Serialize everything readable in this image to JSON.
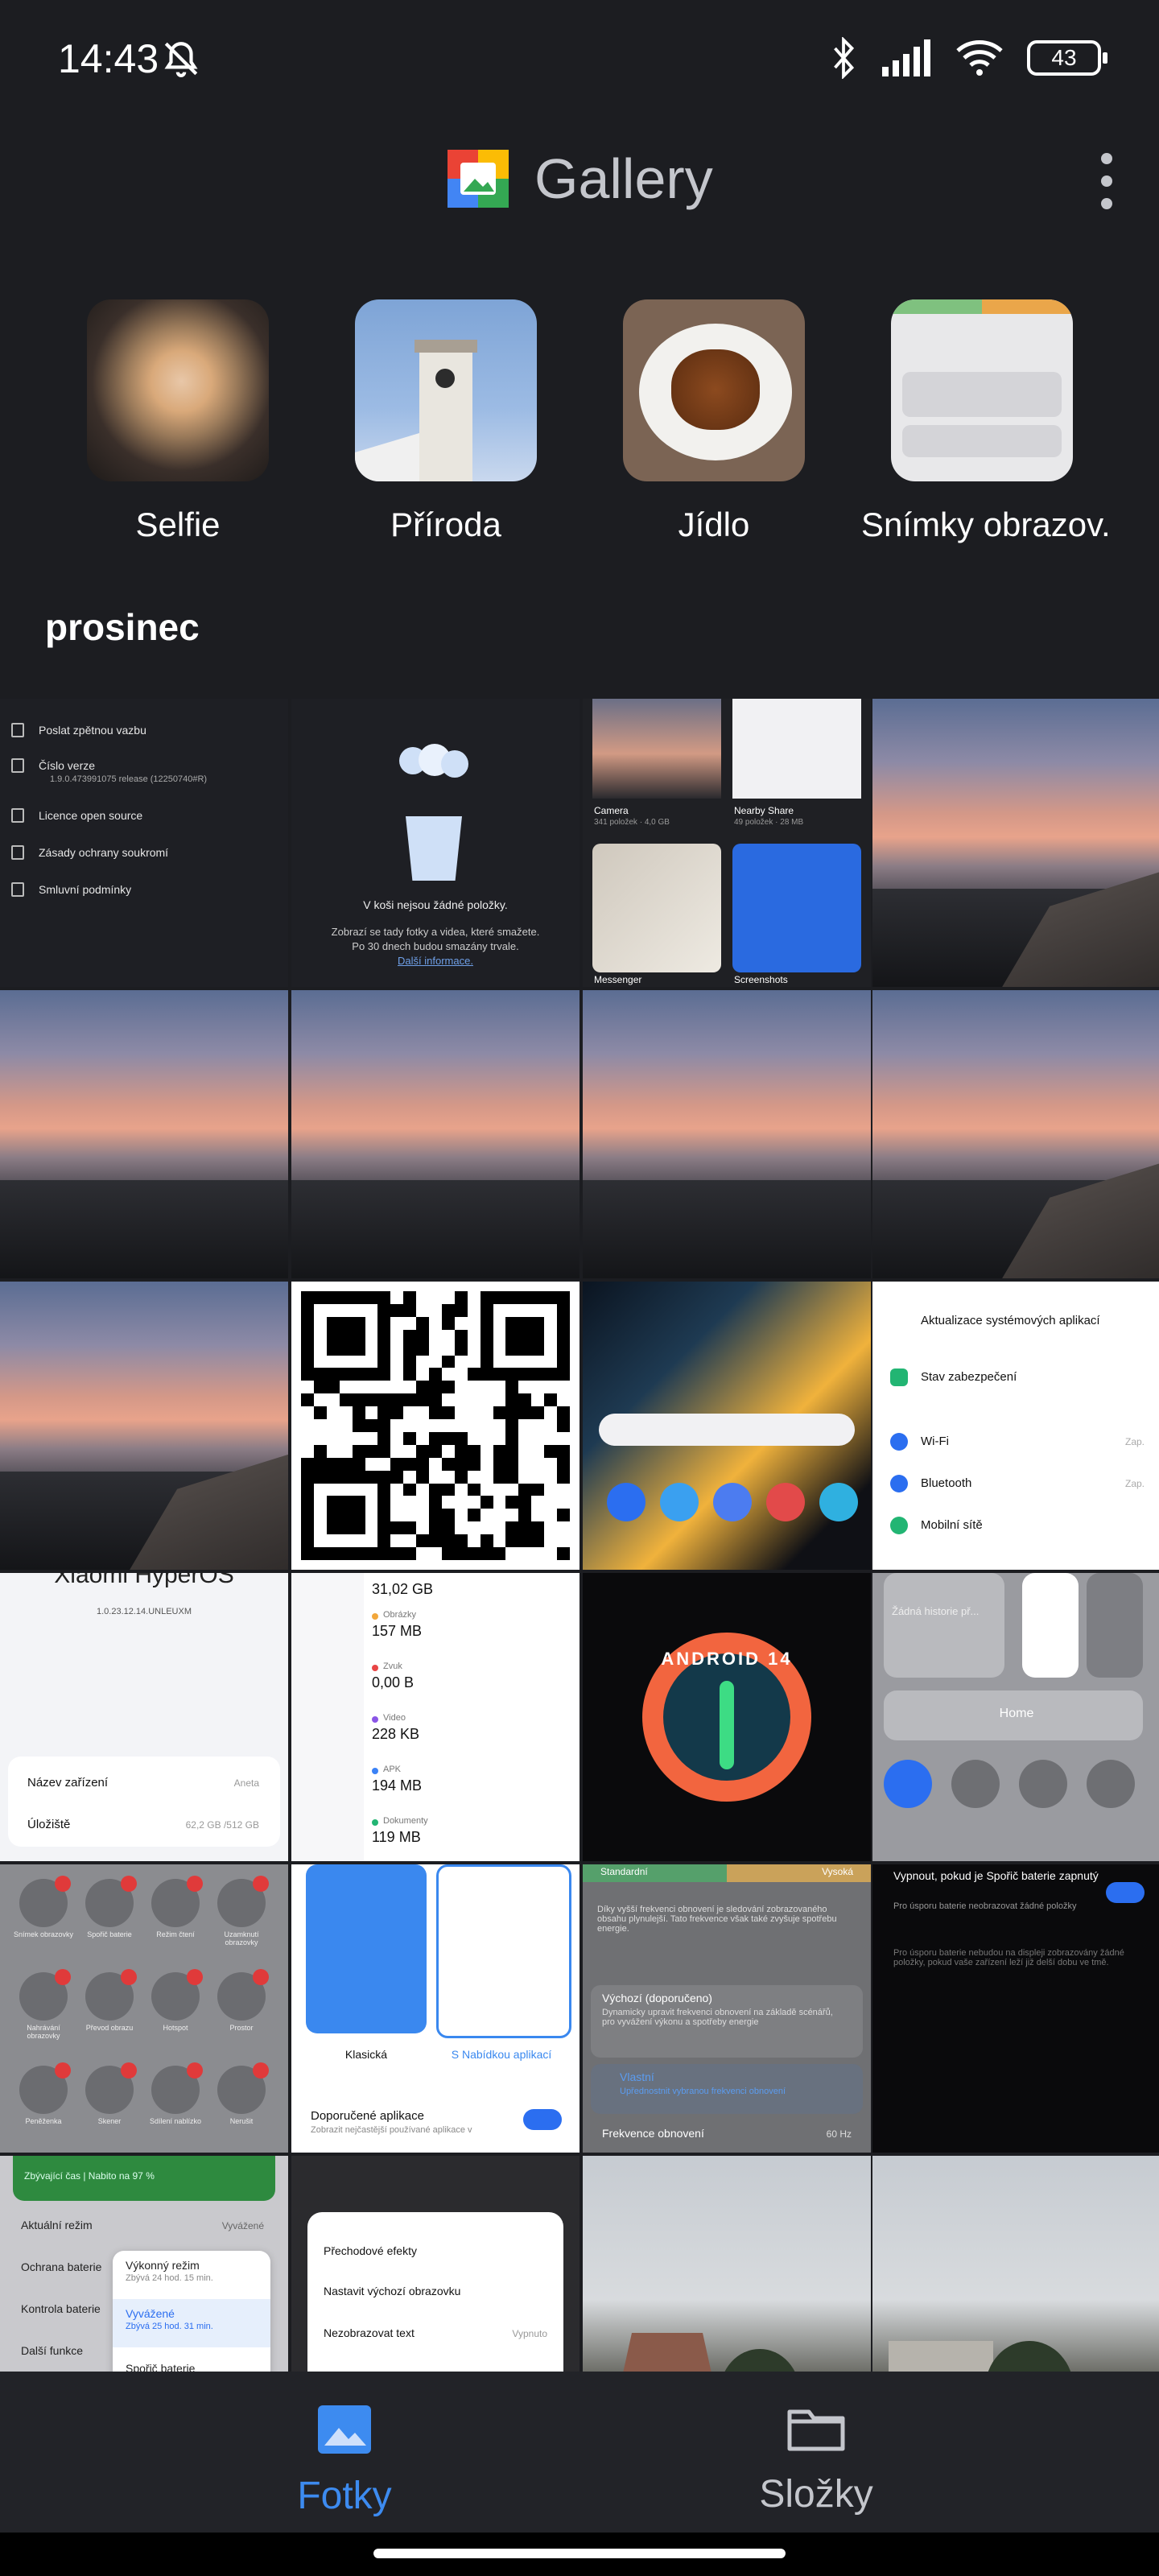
{
  "status_bar": {
    "time": "14:43",
    "battery": "43",
    "icons": [
      "bell-off-icon",
      "bluetooth-icon",
      "signal-icon",
      "wifi-icon",
      "battery-icon"
    ]
  },
  "header": {
    "title": "Gallery",
    "more_icon": "more-vertical-icon"
  },
  "albums": [
    {
      "label": "Selfie"
    },
    {
      "label": "Příroda"
    },
    {
      "label": "Jídlo"
    },
    {
      "label": "Snímky obrazov."
    }
  ],
  "section": {
    "title": "prosinec"
  },
  "cells": {
    "settings_list": [
      "Poslat zpětnou vazbu",
      "Číslo verze",
      "1.9.0.473991075 release (12250740#R)",
      "Licence open source",
      "Zásady ochrany soukromí",
      "Smluvní podmínky"
    ],
    "trash": {
      "title": "V koši nejsou žádné položky.",
      "line1": "Zobrazí se tady fotky a videa, které smažete.",
      "line2": "Po 30 dnech budou smazány trvale.",
      "link": "Další informace."
    },
    "albums_tile": {
      "camera": "Camera",
      "camera_sub": "341 položek · 4,0 GB",
      "nearby": "Nearby Share",
      "nearby_sub": "49 položek · 28 MB",
      "messenger": "Messenger",
      "screenshots": "Screenshots"
    },
    "settings_menu": [
      "Aktualizace systémových aplikací",
      "Stav zabezpečení",
      "Wi-Fi",
      "Bluetooth",
      "Mobilní sítě"
    ],
    "settings_values": [
      "Zap.",
      "Zap."
    ],
    "hyperos": {
      "brand": "Xiaomi HyperOS",
      "version": "1.0.23.12.14.UNLEUXM",
      "device_label": "Název zařízení",
      "device_value": "Aneta",
      "storage_label": "Úložiště",
      "storage_value": "62,2 GB /512 GB"
    },
    "storage": {
      "total": "31,02 GB",
      "items": [
        {
          "label": "Obrázky",
          "value": "157 MB",
          "color": "#f2a73b"
        },
        {
          "label": "Zvuk",
          "value": "0,00 B",
          "color": "#e84545"
        },
        {
          "label": "Video",
          "value": "228 KB",
          "color": "#8a55e6"
        },
        {
          "label": "APK",
          "value": "194 MB",
          "color": "#3b82f6"
        },
        {
          "label": "Dokumenty",
          "value": "119 MB",
          "color": "#22b573"
        }
      ]
    },
    "android": {
      "badge": "ANDROID 14"
    },
    "control_center": {
      "media": "Žádná historie př...",
      "home": "Home"
    },
    "tiles_labels": [
      "Snímek obrazovky",
      "Spořič baterie",
      "Režim čtení",
      "Uzamknutí obrazovky",
      "Nahrávání obrazovky",
      "Převod obrazu",
      "Hotspot",
      "Prostor",
      "Peněženka",
      "Skener",
      "Sdílení nablízko",
      "Nerušit"
    ],
    "launcher": {
      "classic": "Klasická",
      "drawer": "S Nabídkou aplikací",
      "rec_title": "Doporučené aplikace",
      "rec_sub": "Zobrazit nejčastější používané aplikace v"
    },
    "refresh": {
      "std": "Standardní",
      "high": "Vysoká",
      "desc": "Díky vyšší frekvenci obnovení je sledování zobrazovaného obsahu plynulejší. Tato frekvence však také zvyšuje spotřebu energie.",
      "opt1": "Výchozí (doporučeno)",
      "opt1_sub": "Dynamicky upravit frekvenci obnovení na základě scénářů, pro vyvážení výkonu a spotřeby energie",
      "opt2": "Vlastní",
      "opt2_sub": "Upřednostnit vybranou frekvenci obnovení",
      "row": "Frekvence obnovení",
      "row_value": "60 Hz"
    },
    "battery_saver": {
      "title": "Vypnout, pokud je Spořič baterie zapnutý",
      "sub": "Pro úsporu baterie neobrazovat žádné položky",
      "sub2": "Pro úsporu baterie nebudou na displeji zobrazovány žádné položky, pokud vaše zařízení leží již delší dobu ve tmě."
    },
    "battery_mode": {
      "time": "Zbývající čas | Nabito na 97 %",
      "mode": "Aktuální režim",
      "mode_value": "Vyvážené",
      "perf": "Výkonný režim",
      "perf_sub": "Zbývá 24 hod. 15 min.",
      "bal": "Vyvážené",
      "bal_sub": "Zbývá 25 hod. 31 min.",
      "saver": "Spořič baterie",
      "r1": "Ochrana baterie",
      "r2": "Kontrola baterie",
      "r3": "Další funkce"
    },
    "transitions": {
      "a": "Přechodové efekty",
      "b": "Nastavit výchozí obrazovku",
      "c": "Nezobrazovat text",
      "c_value": "Vypnuto"
    }
  },
  "bottom_nav": {
    "photos": {
      "label": "Fotky",
      "icon": "photo-icon",
      "active": true
    },
    "folders": {
      "label": "Složky",
      "icon": "folder-icon",
      "active": false
    }
  },
  "colors": {
    "accent": "#3d8bf0",
    "background": "#1c1d21",
    "nav_bg": "#222328"
  }
}
